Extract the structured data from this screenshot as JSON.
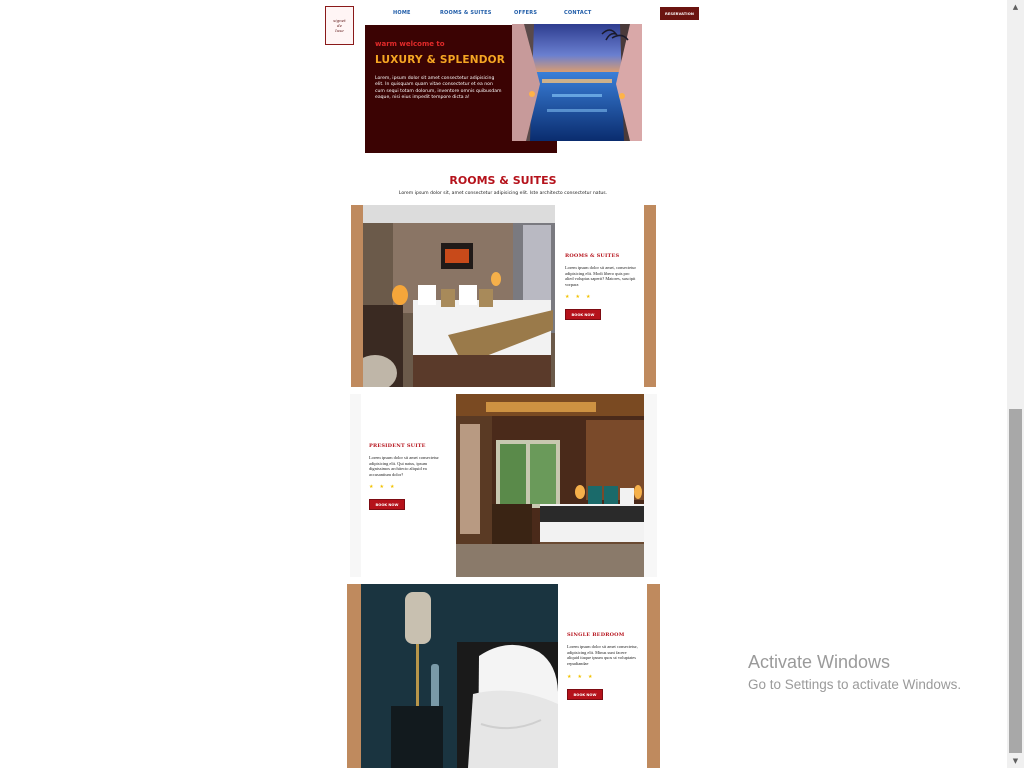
{
  "logo": {
    "text": "signet\nde\nluxe"
  },
  "nav": {
    "links": [
      "HOME",
      "ROOMS & SUITES",
      "OFFERS",
      "CONTACT"
    ],
    "reservation_label": "RESERVATION"
  },
  "hero": {
    "welcome": "warm welcome to",
    "title": "LUXURY & SPLENDOR",
    "body": "Lorem, ipsum dolor sit amet consectetur adipisicing elit. In quisquam quam vitae consectetur et ea non cum sequi totam dolorum, inventore omnis quibusdam eaque, nisi eius impedit tempore dicta a!"
  },
  "section": {
    "title": "ROOMS & SUITES",
    "subtitle": "Lorem ipsum dolor sit, amet consectetur adipisicing elit. Iste architecto consectetur natus."
  },
  "rooms": [
    {
      "title": "ROOMS & SUITES",
      "desc": "Lorem ipsum dolor sit amet, consectetur adipisicing elit. Modi libero quis pro alied voluptas saperit? Maiores, suscipit vorpara",
      "stars": "★★★",
      "button": "BOOK NOW"
    },
    {
      "title": "PRESIDENT SUITE",
      "desc": "Lorem ipsum dolor sit amet consectetur adipisicing elit. Qui natus, ipsum dignissimos architecto aliquid ea accusantium dolor?",
      "stars": "★★★",
      "button": "BOOK NOW"
    },
    {
      "title": "SINGLE BEDROOM",
      "desc": "Lorem ipsum dolor sit amet consectetur, adipisicing elit. Minus sunt facere aliquid itaque ipsum quos ut voluptates repudiandae",
      "stars": "★★★",
      "button": "BOOK NOW"
    }
  ],
  "scrollbar": {
    "up_icon": "▲",
    "down_icon": "▼"
  },
  "watermark": {
    "title": "Activate Windows",
    "subtitle": "Go to Settings to activate Windows."
  }
}
